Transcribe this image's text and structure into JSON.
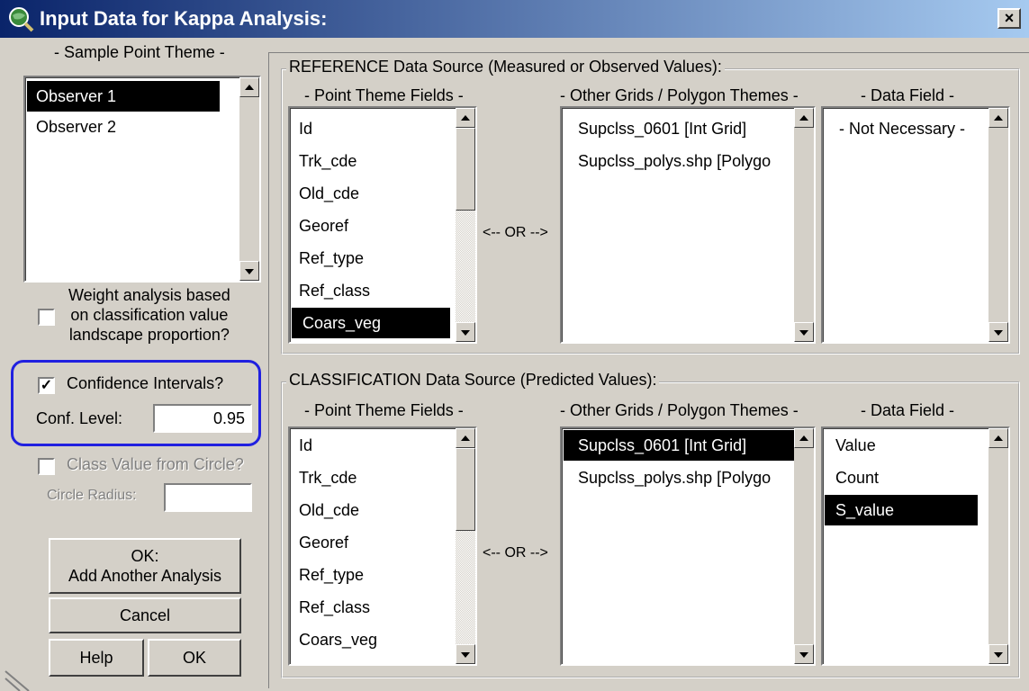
{
  "window": {
    "title": "Input Data for Kappa Analysis:",
    "close_label": "×",
    "app_icon": "globe-magnifier-icon"
  },
  "sample_point_theme": {
    "label": "- Sample Point Theme -",
    "items": [
      "Observer 1",
      "Observer 2"
    ],
    "selected_index": 0
  },
  "weight_option": {
    "checked": false,
    "label_line1": "Weight analysis based",
    "label_line2": "on classification value",
    "label_line3": "landscape proportion?"
  },
  "confidence": {
    "checked": true,
    "checkbox_label": "Confidence Intervals?",
    "level_label": "Conf. Level:",
    "level_value": "0.95",
    "highlight_color": "#2020e0"
  },
  "circle": {
    "checked": false,
    "checkbox_label": "Class Value from Circle?",
    "radius_label": "Circle Radius:",
    "radius_value": ""
  },
  "buttons": {
    "add_another_line1": "OK:",
    "add_another_line2": "Add Another Analysis",
    "cancel": "Cancel",
    "help": "Help",
    "ok": "OK"
  },
  "reference": {
    "group_title": "REFERENCE Data Source (Measured or Observed Values):",
    "point_fields_label": "- Point Theme Fields -",
    "point_fields": [
      "Id",
      "Trk_cde",
      "Old_cde",
      "Georef",
      "Ref_type",
      "Ref_class",
      "Coars_veg"
    ],
    "point_fields_selected": 6,
    "or_label": "<-- OR -->",
    "grids_label": "- Other Grids / Polygon Themes -",
    "grids": [
      "Supclss_0601 [Int Grid]",
      "Supclss_polys.shp [Polygo"
    ],
    "grids_selected": -1,
    "data_field_label": "- Data Field -",
    "data_fields": [
      "- Not Necessary -"
    ],
    "data_fields_selected": -1
  },
  "classification": {
    "group_title": "CLASSIFICATION Data Source (Predicted Values):",
    "point_fields_label": "- Point Theme Fields -",
    "point_fields": [
      "Id",
      "Trk_cde",
      "Old_cde",
      "Georef",
      "Ref_type",
      "Ref_class",
      "Coars_veg"
    ],
    "point_fields_selected": -1,
    "or_label": "<-- OR -->",
    "grids_label": "- Other Grids / Polygon Themes -",
    "grids": [
      "Supclss_0601 [Int Grid]",
      "Supclss_polys.shp [Polygo"
    ],
    "grids_selected": 0,
    "data_field_label": "- Data Field -",
    "data_fields": [
      "Value",
      "Count",
      "S_value"
    ],
    "data_fields_selected": 2
  }
}
